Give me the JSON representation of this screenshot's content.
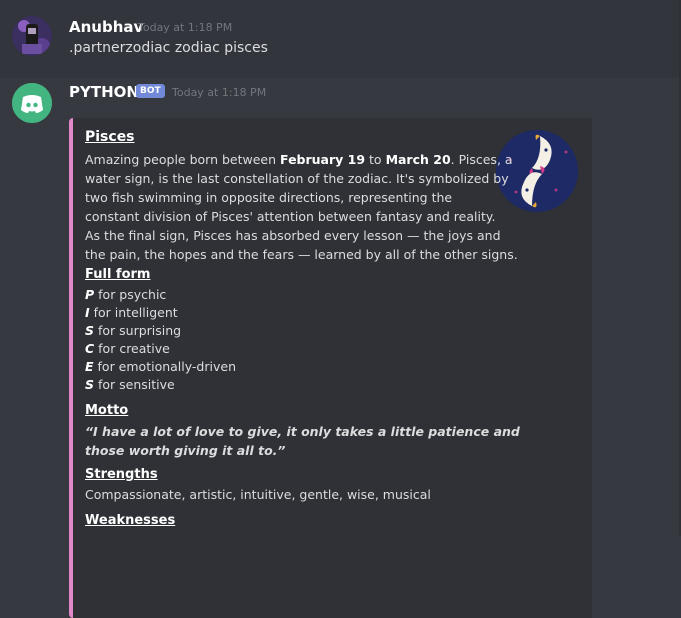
{
  "message1": {
    "username": "Anubhav",
    "timestamp": "Today at 1:18 PM",
    "text": ".partnerzodiac zodiac pisces"
  },
  "message2": {
    "username": "PYTHON",
    "bot_tag": "BOT",
    "timestamp": "Today at 1:18 PM",
    "embed": {
      "accent_color": "#e188c9",
      "title": "Pisces",
      "desc_lines": [
        [
          "Amazing people born between ",
          "February 19",
          " to ",
          "March 20",
          ". Pisces, a"
        ],
        "water sign, is the last constellation of the zodiac. It's symbolized by",
        "two fish swimming in opposite directions, representing the",
        "constant division of Pisces' attention between fantasy and reality.",
        "As the final sign, Pisces has absorbed every lesson — the joys and",
        "the pain, the hopes and the fears — learned by all of the other signs."
      ],
      "full_form_title": "Full form",
      "full_form": [
        {
          "letter": "P",
          "text": " for psychic"
        },
        {
          "letter": "I",
          "text": " for intelligent"
        },
        {
          "letter": "S",
          "text": " for surprising"
        },
        {
          "letter": "C",
          "text": " for creative"
        },
        {
          "letter": "E",
          "text": " for emotionally-driven"
        },
        {
          "letter": "S",
          "text": " for sensitive"
        }
      ],
      "motto_title": "Motto",
      "motto_lines": [
        "“I have a lot of love to give, it only takes a little patience and",
        "those worth giving it all to.”"
      ],
      "strengths_title": "Strengths",
      "strengths": "Compassionate, artistic, intuitive, gentle, wise, musical",
      "weaknesses_title": "Weaknesses",
      "thumbnail_icon": "pisces-fish-icon"
    }
  }
}
